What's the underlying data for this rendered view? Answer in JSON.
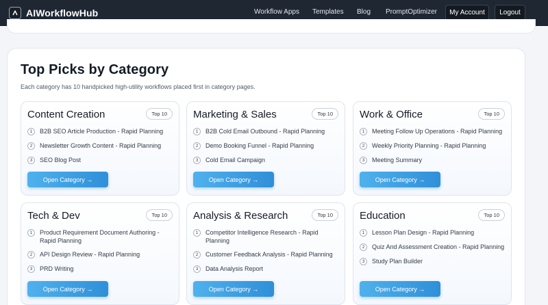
{
  "brand": {
    "name": "AIWorkflowHub"
  },
  "nav": {
    "links": [
      "Workflow Apps",
      "Templates",
      "Blog",
      "PromptOptimizer"
    ],
    "account_label": "My Account",
    "logout_label": "Logout"
  },
  "section": {
    "title": "Top Picks by Category",
    "subtitle": "Each category has 10 handpicked high-utility workflows placed first in category pages."
  },
  "cards": [
    {
      "title": "Content Creation",
      "badge": "Top 10",
      "button": "Open Category →",
      "items": [
        {
          "num": "1",
          "text": "B2B SEO Article Production - Rapid Planning"
        },
        {
          "num": "2",
          "text": "Newsletter Growth Content - Rapid Planning"
        },
        {
          "num": "3",
          "text": "SEO Blog Post"
        }
      ]
    },
    {
      "title": "Marketing & Sales",
      "badge": "Top 10",
      "button": "Open Category →",
      "items": [
        {
          "num": "1",
          "text": "B2B Cold Email Outbound - Rapid Planning"
        },
        {
          "num": "2",
          "text": "Demo Booking Funnel - Rapid Planning"
        },
        {
          "num": "3",
          "text": "Cold Email Campaign"
        }
      ]
    },
    {
      "title": "Work & Office",
      "badge": "Top 10",
      "button": "Open Category →",
      "items": [
        {
          "num": "1",
          "text": "Meeting Follow Up Operations - Rapid Planning"
        },
        {
          "num": "2",
          "text": "Weekly Priority Planning - Rapid Planning"
        },
        {
          "num": "3",
          "text": "Meeting Summary"
        }
      ]
    },
    {
      "title": "Tech & Dev",
      "badge": "Top 10",
      "button": "Open Category →",
      "items": [
        {
          "num": "1",
          "text": "Product Requirement Document Authoring - Rapid Planning"
        },
        {
          "num": "2",
          "text": "API Design Review - Rapid Planning"
        },
        {
          "num": "3",
          "text": "PRD Writing"
        }
      ]
    },
    {
      "title": "Analysis & Research",
      "badge": "Top 10",
      "button": "Open Category →",
      "items": [
        {
          "num": "1",
          "text": "Competitor Intelligence Research - Rapid Planning"
        },
        {
          "num": "2",
          "text": "Customer Feedback Analysis - Rapid Planning"
        },
        {
          "num": "3",
          "text": "Data Analysis Report"
        }
      ]
    },
    {
      "title": "Education",
      "badge": "Top 10",
      "button": "Open Category →",
      "items": [
        {
          "num": "1",
          "text": "Lesson Plan Design - Rapid Planning"
        },
        {
          "num": "2",
          "text": "Quiz And Assessment Creation - Rapid Planning"
        },
        {
          "num": "3",
          "text": "Study Plan Builder"
        }
      ]
    }
  ]
}
